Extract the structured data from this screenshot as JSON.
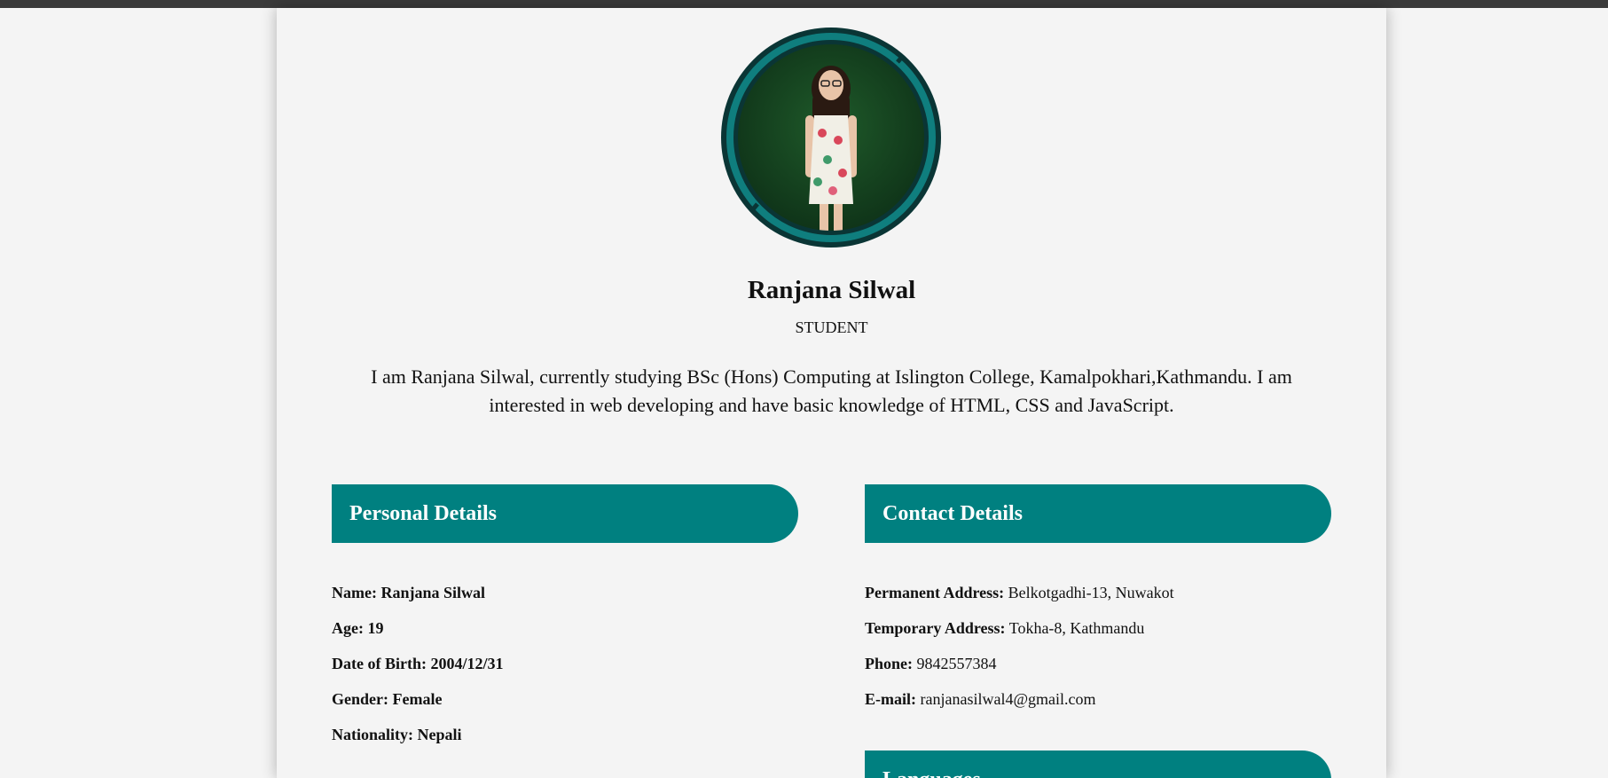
{
  "profile": {
    "name": "Ranjana Silwal",
    "role": "STUDENT",
    "bio": "I am Ranjana Silwal, currently studying BSc (Hons) Computing at Islington College, Kamalpokhari,Kathmandu. I am interested in web developing and have basic knowledge of HTML, CSS and JavaScript."
  },
  "personal": {
    "title": "Personal Details",
    "items": [
      "Name: Ranjana Silwal",
      "Age: 19",
      "Date of Birth: 2004/12/31",
      "Gender: Female",
      "Nationality: Nepali"
    ]
  },
  "contact": {
    "title": "Contact Details",
    "items": [
      {
        "label": "Permanent Address:",
        "value": "Belkotgadhi-13, Nuwakot"
      },
      {
        "label": "Temporary Address:",
        "value": "Tokha-8, Kathmandu"
      },
      {
        "label": "Phone:",
        "value": "9842557384"
      },
      {
        "label": "E-mail:",
        "value": "ranjanasilwal4@gmail.com"
      }
    ]
  },
  "languages": {
    "title": "Languages"
  },
  "colors": {
    "accent": "#008080",
    "ring_dark": "#0a3535",
    "background": "#f4f4f4"
  }
}
